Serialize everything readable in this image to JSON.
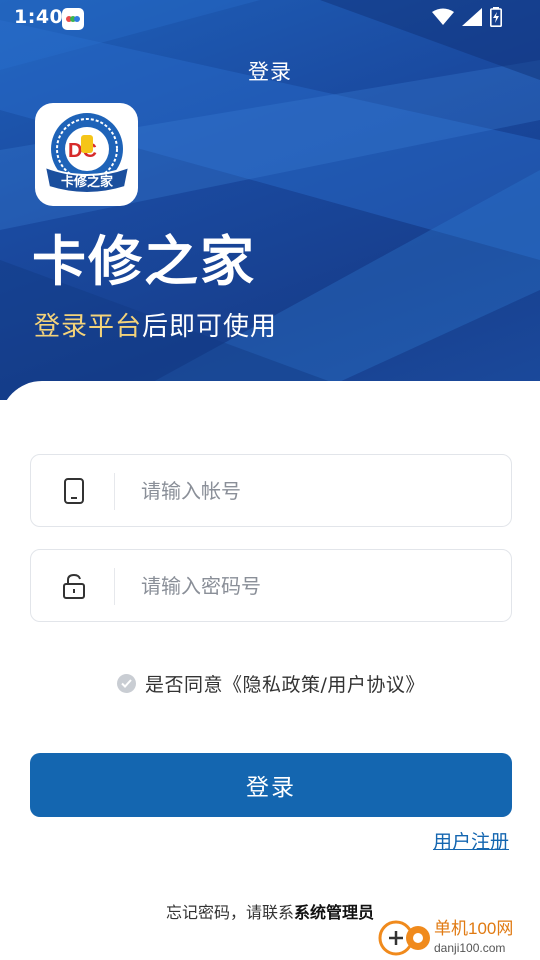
{
  "status_bar": {
    "time": "1:40"
  },
  "header": {
    "title": "登录"
  },
  "hero": {
    "app_name": "卡修之家",
    "subtitle_highlight": "登录平台",
    "subtitle_rest": "后即可使用",
    "logo_text": "卡修之家",
    "logo_letters": "DC"
  },
  "form": {
    "account_placeholder": "请输入帐号",
    "password_placeholder": "请输入密码号",
    "agree_text": "是否同意《隐私政策/用户协议》",
    "login_label": "登录",
    "register_label": "用户注册",
    "forgot_prefix": "忘记密码，请联系",
    "forgot_admin": "系统管理员"
  },
  "watermark": {
    "brand": "单机100网",
    "url": "danji100.com"
  },
  "colors": {
    "primary": "#1466b0",
    "hero_bg": "#1a4aa0",
    "highlight": "#f4d37a"
  },
  "icons": [
    "phone-icon",
    "lock-icon",
    "check-icon",
    "wifi-icon",
    "signal-icon",
    "battery-icon"
  ]
}
